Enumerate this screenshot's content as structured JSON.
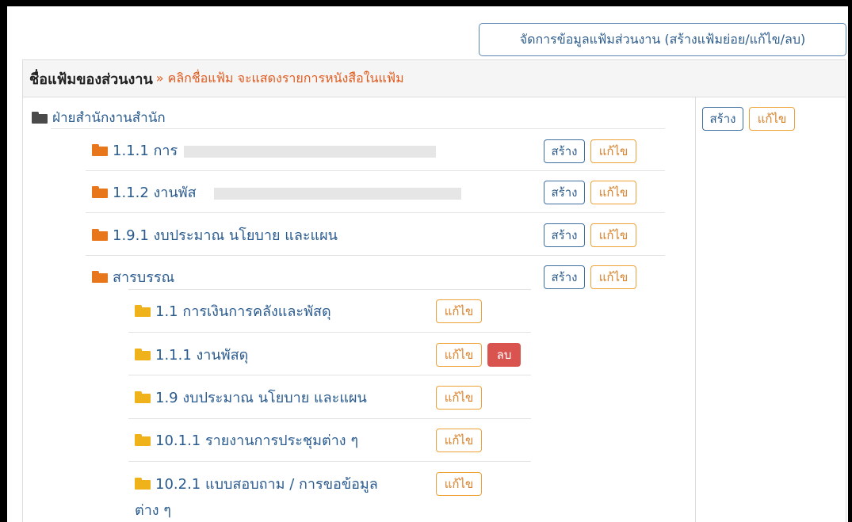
{
  "header": {
    "manage_button": "จัดการข้อมูลแฟ้มส่วนงาน (สร้างแฟ้มย่อย/แก้ไข/ลบ)",
    "title": "ชื่อแฟ้มของส่วนงาน",
    "hint": "» คลิกชื่อแฟ้ม จะแสดงรายการหนังสือในแฟ้ม"
  },
  "root": {
    "label": "ฝ่ายสำนักงานสำนัก",
    "create_label": "สร้าง",
    "edit_label": "แก้ไข"
  },
  "level1": [
    {
      "label": "1.1.1 การ",
      "create_label": "สร้าง",
      "edit_label": "แก้ไข"
    },
    {
      "label": "1.1.2 งานพัส",
      "create_label": "สร้าง",
      "edit_label": "แก้ไข"
    },
    {
      "label": "1.9.1 งบประมาณ นโยบาย และแผน",
      "create_label": "สร้าง",
      "edit_label": "แก้ไข"
    },
    {
      "label": "สารบรรณ",
      "create_label": "สร้าง",
      "edit_label": "แก้ไข"
    }
  ],
  "level2": [
    {
      "label": "1.1 การเงินการคลังและพัสดุ",
      "edit_label": "แก้ไข"
    },
    {
      "label": "1.1.1 งานพัสดุ",
      "edit_label": "แก้ไข",
      "delete_label": "ลบ"
    },
    {
      "label": "1.9 งบประมาณ นโยบาย และแผน",
      "edit_label": "แก้ไข"
    },
    {
      "label": "10.1.1 รายงานการประชุมต่าง ๆ",
      "edit_label": "แก้ไข"
    },
    {
      "label_line1": "10.2.1 แบบสอบถาม / การขอข้อมูล",
      "label_line2": "ต่าง ๆ",
      "edit_label": "แก้ไข"
    }
  ],
  "icons": {
    "root": "folder-icon-dark",
    "level1": "folder-icon-orange",
    "level2": "folder-icon-yellow"
  },
  "colors": {
    "link": "#2a5b8f",
    "hint": "#e05a1e",
    "create_border": "#3f6f9f",
    "edit_border": "#eea236",
    "delete_bg": "#d9534f"
  }
}
